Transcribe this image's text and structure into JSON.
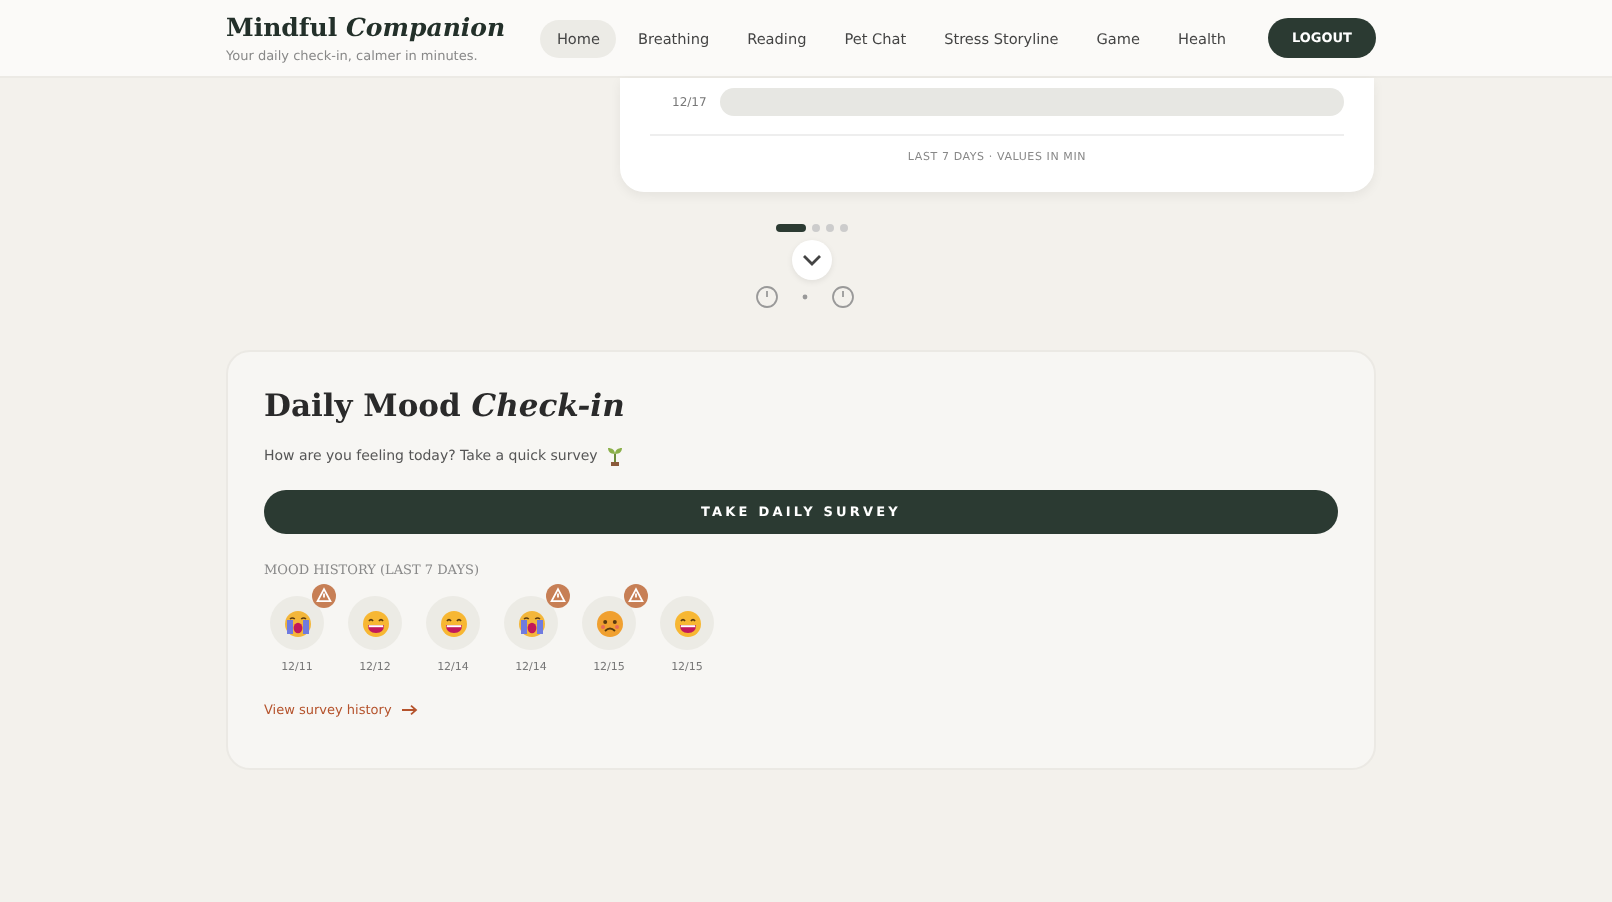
{
  "header": {
    "brand": "Mindful",
    "brand_accent": "Companion",
    "tagline": "Your daily check-in, calmer in minutes.",
    "nav": [
      {
        "label": "Home",
        "selected": true
      },
      {
        "label": "Breathing",
        "selected": false
      },
      {
        "label": "Reading",
        "selected": false
      },
      {
        "label": "Pet Chat",
        "selected": false
      },
      {
        "label": "Stress Storyline",
        "selected": false
      },
      {
        "label": "Game",
        "selected": false
      },
      {
        "label": "Health",
        "selected": false
      }
    ],
    "logout": "LOGOUT"
  },
  "activity_card": {
    "rows": [
      {
        "date": "12/17"
      }
    ],
    "caption": "LAST 7 DAYS · VALUES IN MIN"
  },
  "carousel": {
    "dots": [
      {
        "selected": true
      },
      {
        "selected": false
      },
      {
        "selected": false
      },
      {
        "selected": false
      }
    ]
  },
  "mood_card": {
    "title": "Daily Mood",
    "title_accent": "Check-in",
    "prompt": "How are you feeling today? Take a quick survey",
    "survey_button": "TAKE DAILY SURVEY",
    "history_label": "MOOD HISTORY (LAST 7 DAYS)",
    "history": [
      {
        "date": "12/11",
        "kind": "crying",
        "flagged": true
      },
      {
        "date": "12/12",
        "kind": "grinning",
        "flagged": false
      },
      {
        "date": "12/14",
        "kind": "grinning",
        "flagged": false
      },
      {
        "date": "12/14",
        "kind": "crying",
        "flagged": true
      },
      {
        "date": "12/15",
        "kind": "anxious",
        "flagged": true
      },
      {
        "date": "12/15",
        "kind": "grinning",
        "flagged": false
      }
    ],
    "history_link": "View survey history"
  }
}
